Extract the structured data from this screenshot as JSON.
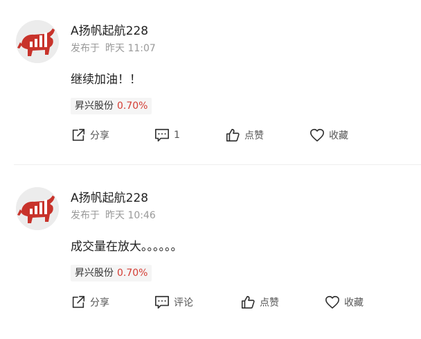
{
  "posts": [
    {
      "username": "A扬帆起航228",
      "published_label": "发布于",
      "time": "昨天 11:07",
      "content": "继续加油！！",
      "stock": {
        "name": "昇兴股份",
        "change": "0.70%"
      },
      "actions": {
        "share": "分享",
        "comment": "1",
        "like": "点赞",
        "favorite": "收藏"
      }
    },
    {
      "username": "A扬帆起航228",
      "published_label": "发布于",
      "time": "昨天 10:46",
      "content": "成交量在放大。。。。。。",
      "stock": {
        "name": "昇兴股份",
        "change": "0.70%"
      },
      "actions": {
        "share": "分享",
        "comment": "评论",
        "like": "点赞",
        "favorite": "收藏"
      }
    }
  ],
  "colors": {
    "stock_change": "#d43c33",
    "meta_text": "#999999",
    "avatar_red": "#c8332b"
  },
  "icons": {
    "avatar": "red-bull-avatar",
    "share": "share-icon",
    "comment": "comment-icon",
    "like": "thumbs-up-icon",
    "favorite": "heart-icon"
  }
}
